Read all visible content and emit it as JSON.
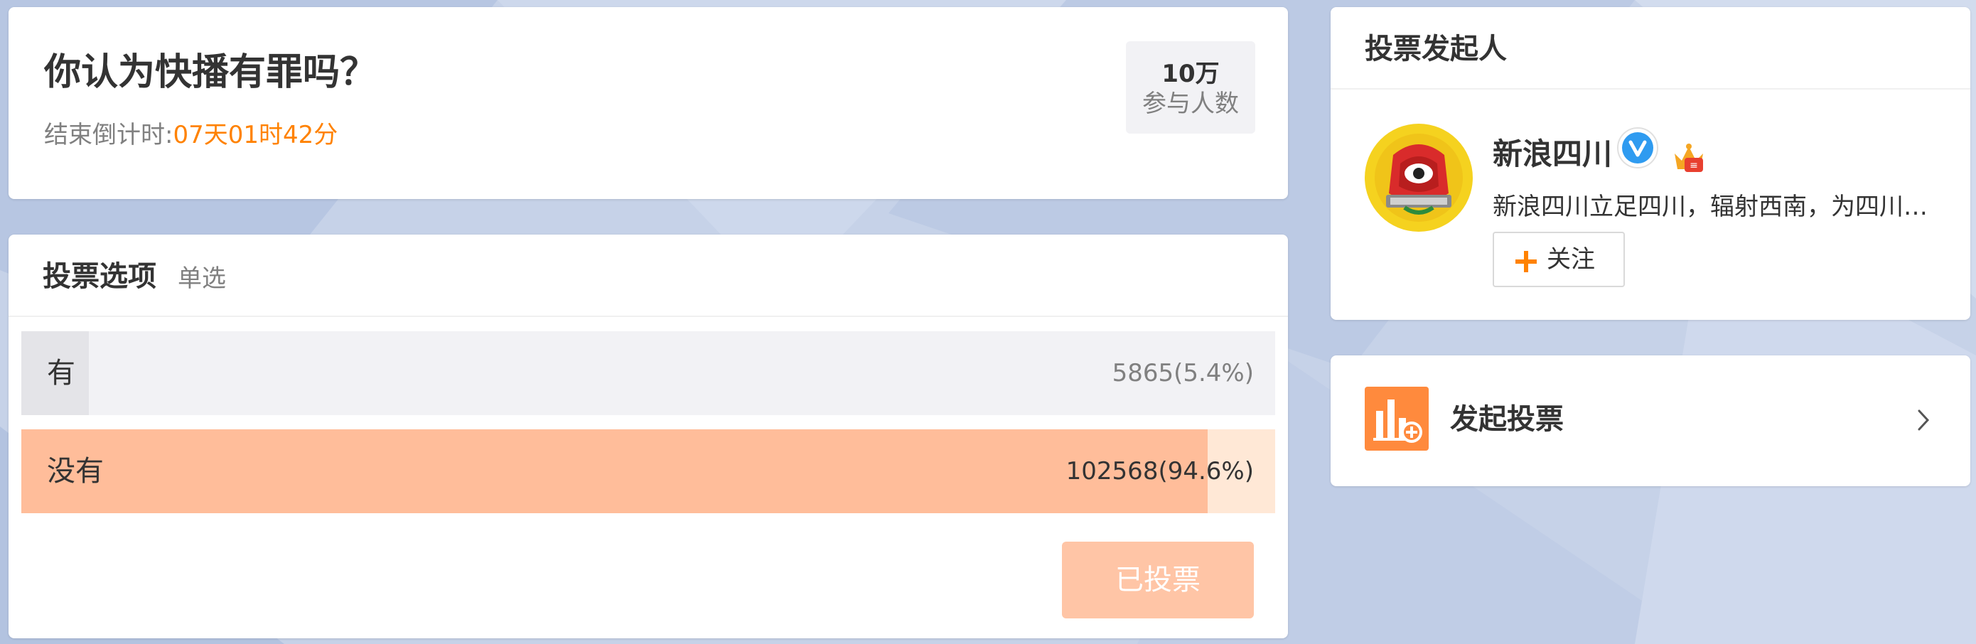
{
  "question": {
    "title": "你认为快播有罪吗？",
    "countdown_label": "结束倒计时:",
    "countdown_value": "07天01时42分",
    "participants_count": "10万",
    "participants_label": "参与人数"
  },
  "options": {
    "title": "投票选项",
    "type": "单选",
    "items": [
      {
        "label": "有",
        "count_text": "5865(5.4%)",
        "percent": 5.4
      },
      {
        "label": "没有",
        "count_text": "102568(94.6%)",
        "percent": 94.6
      }
    ],
    "voted_button": "已投票"
  },
  "initiator": {
    "title": "投票发起人",
    "name": "新浪四川",
    "description": "新浪四川立足四川，辐射西南，为四川网友提供本地资讯",
    "follow_label": "关注",
    "avatar_icon": "sina-logo-avatar",
    "badges": [
      "verified-v-icon",
      "crown-level-icon"
    ]
  },
  "start_vote": {
    "label": "发起投票",
    "icon": "chart-plus-icon"
  },
  "colors": {
    "accent_orange": "#ff8200",
    "bar_fill_selected": "#ffbd9a",
    "bar_track_selected": "#ffe8d6",
    "bar_fill": "#e4e4e8",
    "bar_track": "#f2f2f5",
    "voted_button_bg": "#ffc5a6",
    "verified_blue": "#2f9bf0"
  }
}
